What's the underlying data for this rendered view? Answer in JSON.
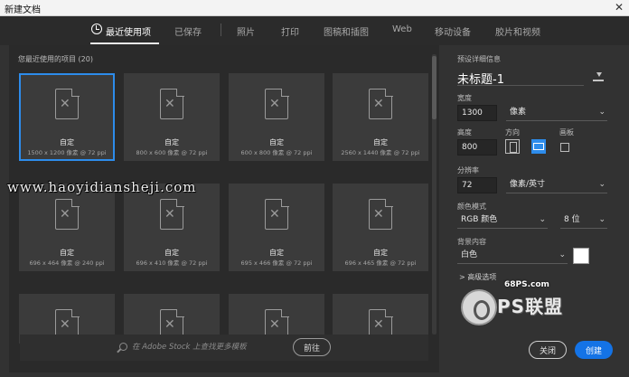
{
  "window": {
    "title": "新建文档",
    "close_glyph": "✕"
  },
  "tabs": [
    {
      "label": "最近使用项",
      "active": true
    },
    {
      "label": "已保存"
    },
    {
      "label": "照片"
    },
    {
      "label": "打印"
    },
    {
      "label": "图稿和插图"
    },
    {
      "label": "Web"
    },
    {
      "label": "移动设备"
    },
    {
      "label": "胶片和视频"
    }
  ],
  "recent": {
    "header": "您最近使用的项目",
    "count": "(20)",
    "items": [
      {
        "name": "自定",
        "size": "1500 x 1200 像素 @ 72 ppi",
        "selected": true
      },
      {
        "name": "自定",
        "size": "800 x 600 像素 @ 72 ppi"
      },
      {
        "name": "自定",
        "size": "600 x 800 像素 @ 72 ppi"
      },
      {
        "name": "自定",
        "size": "2560 x 1440 像素 @ 72 ppi"
      },
      {
        "name": "自定",
        "size": "696 x 464 像素 @ 240 ppi"
      },
      {
        "name": "自定",
        "size": "696 x 410 像素 @ 72 ppi"
      },
      {
        "name": "自定",
        "size": "695 x 466 像素 @ 72 ppi"
      },
      {
        "name": "自定",
        "size": "696 x 465 像素 @ 72 ppi"
      },
      {
        "name": "",
        "size": ""
      },
      {
        "name": "",
        "size": ""
      },
      {
        "name": "",
        "size": ""
      },
      {
        "name": "",
        "size": ""
      }
    ]
  },
  "search": {
    "placeholder": "在 Adobe Stock 上查找更多模板",
    "go_label": "前往"
  },
  "watermark": "www.haoyidiansheji.com",
  "preset": {
    "header": "预设详细信息",
    "name": "未标题-1",
    "width_label": "宽度",
    "width_value": "1300",
    "width_unit": "像素",
    "height_label": "高度",
    "height_value": "800",
    "orientation_label": "方向",
    "artboard_label": "画板",
    "resolution_label": "分辨率",
    "resolution_value": "72",
    "resolution_unit": "像素/英寸",
    "color_mode_label": "颜色模式",
    "color_mode_value": "RGB 颜色",
    "bit_depth_value": "8 位",
    "background_label": "背景内容",
    "background_value": "白色",
    "background_color": "#ffffff",
    "advanced_label": "> 高级选项"
  },
  "actions": {
    "close_label": "关闭",
    "create_label": "创建"
  },
  "logo": {
    "site": "68PS.com",
    "name": "PS联盟"
  },
  "icons": {
    "recent": "clock-icon",
    "document": "document-icon",
    "search": "search-icon",
    "save_preset": "save-preset-icon",
    "chevron": "chevron-down-icon"
  }
}
